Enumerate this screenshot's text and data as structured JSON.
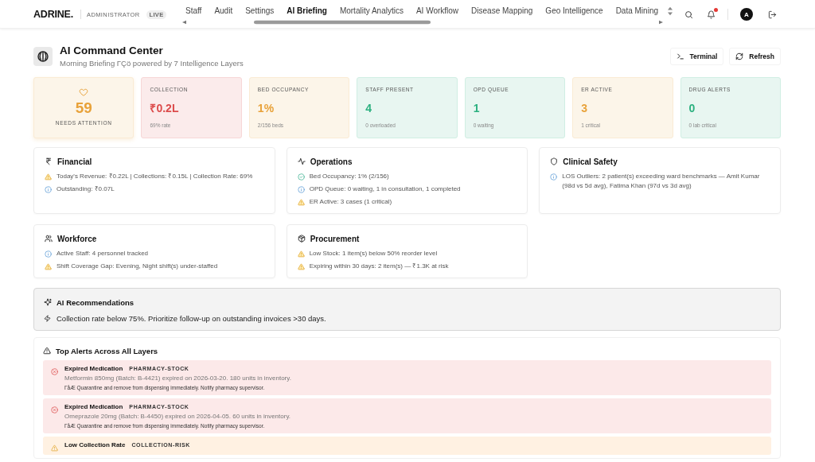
{
  "nav": {
    "logo": "ADRINE.",
    "role": "ADMINISTRATOR",
    "badge": "LIVE",
    "tabs": [
      {
        "label": "Staff",
        "selected": false
      },
      {
        "label": "Audit",
        "selected": false
      },
      {
        "label": "Settings",
        "selected": false
      },
      {
        "label": "AI Briefing",
        "selected": true
      },
      {
        "label": "Mortality Analytics",
        "selected": false
      },
      {
        "label": "AI Workflow",
        "selected": false
      },
      {
        "label": "Disease Mapping",
        "selected": false
      },
      {
        "label": "Geo Intelligence",
        "selected": false
      },
      {
        "label": "Data Mining",
        "selected": false
      }
    ],
    "unread": true,
    "avatar": "A"
  },
  "header": {
    "title": "AI Command Center",
    "subtitle": "Morning Briefing ΓÇö powered by 7 Intelligence Layers",
    "buttons": [
      {
        "kind": "terminal",
        "label": "Terminal"
      },
      {
        "kind": "refresh",
        "label": "Refresh"
      }
    ]
  },
  "stats": [
    {
      "kind": "summary",
      "color": "#e8a23a",
      "value": "59",
      "label": "NEEDS ATTENTION"
    },
    {
      "kind": "metric",
      "color": "#dc4b4b",
      "label": "COLLECTION",
      "value": "₹0.2L",
      "note": "69% rate"
    },
    {
      "kind": "metric",
      "color": "#e8a23a",
      "label": "BED OCCUPANCY",
      "value": "1%",
      "note": "2/156 beds"
    },
    {
      "kind": "metric",
      "color": "#2bb07f",
      "label": "STAFF PRESENT",
      "value": "4",
      "note": "0 overloaded"
    },
    {
      "kind": "metric",
      "color": "#2bb07f",
      "label": "OPD QUEUE",
      "value": "1",
      "note": "0 waiting"
    },
    {
      "kind": "metric",
      "color": "#e8a23a",
      "label": "ER ACTIVE",
      "value": "3",
      "note": "1 critical"
    },
    {
      "kind": "metric",
      "color": "#2bb07f",
      "label": "DRUG ALERTS",
      "value": "0",
      "note": "0 lab critical"
    }
  ],
  "layers": [
    {
      "kind": "financial",
      "title": "Financial",
      "items": [
        {
          "kind": "warning",
          "text": "Today's Revenue: ₹0.22L | Collections: ₹0.15L | Collection Rate: 69%"
        },
        {
          "kind": "info",
          "text": "Outstanding: ₹0.07L"
        }
      ]
    },
    {
      "kind": "operations",
      "title": "Operations",
      "items": [
        {
          "kind": "check",
          "text": "Bed Occupancy: 1% (2/156)"
        },
        {
          "kind": "info",
          "text": "OPD Queue: 0 waiting, 1 in consultation, 1 completed"
        },
        {
          "kind": "warning",
          "text": "ER Active: 3 cases (1 critical)"
        }
      ]
    },
    {
      "kind": "clinical",
      "title": "Clinical Safety",
      "items": [
        {
          "kind": "info",
          "text": "LOS Outliers: 2 patient(s) exceeding ward benchmarks — Amit Kumar (98d vs 5d avg), Fatima Khan (97d vs 3d avg)"
        }
      ]
    },
    {
      "kind": "workforce",
      "title": "Workforce",
      "items": [
        {
          "kind": "info",
          "text": "Active Staff: 4 personnel tracked"
        },
        {
          "kind": "warning",
          "text": "Shift Coverage Gap: Evening, Night shift(s) under-staffed"
        }
      ]
    },
    {
      "kind": "procurement",
      "title": "Procurement",
      "items": [
        {
          "kind": "warning",
          "text": "Low Stock: 1 item(s) below 50% reorder level"
        },
        {
          "kind": "warning",
          "text": "Expiring within 30 days: 2 item(s) — ₹1.3K at risk"
        }
      ]
    }
  ],
  "recommendations": {
    "title": "AI Recommendations",
    "items": [
      "Collection rate below 75%. Prioritize follow-up on outstanding invoices >30 days."
    ]
  },
  "alerts": {
    "title": "Top Alerts Across All Layers",
    "items": [
      {
        "kind": "critical",
        "title": "Expired Medication",
        "tag": "PHARMACY-STOCK",
        "detail": "Metformin 850mg (Batch: B-4421) expired on 2026-03-20. 180 units in inventory.",
        "action": "ΓåÆ Quarantine and remove from dispensing immediately. Notify pharmacy supervisor."
      },
      {
        "kind": "critical",
        "title": "Expired Medication",
        "tag": "PHARMACY-STOCK",
        "detail": "Omeprazole 20mg (Batch: B-4450) expired on 2026-04-05. 60 units in inventory.",
        "action": "ΓåÆ Quarantine and remove from dispensing immediately. Notify pharmacy supervisor."
      },
      {
        "kind": "warning",
        "title": "Low Collection Rate",
        "tag": "COLLECTION-RISK"
      }
    ]
  }
}
